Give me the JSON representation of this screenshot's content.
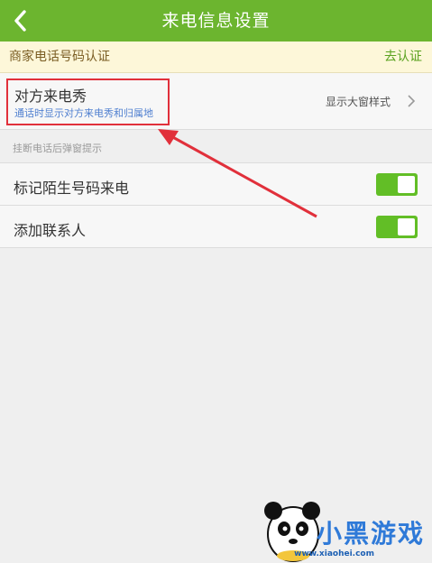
{
  "header": {
    "title": "来电信息设置",
    "back_icon": "chevron-left-icon"
  },
  "merchant_banner": {
    "label": "商家电话号码认证",
    "action": "去认证"
  },
  "caller_show": {
    "title": "对方来电秀",
    "description": "通话时显示对方来电秀和归属地",
    "value": "显示大窗样式",
    "chevron_icon": "chevron-right-icon"
  },
  "section": {
    "title": "挂断电话后弹窗提示"
  },
  "settings": [
    {
      "label": "标记陌生号码来电",
      "enabled": true
    },
    {
      "label": "添加联系人",
      "enabled": true
    }
  ],
  "watermark": {
    "brand": "小黑游戏",
    "site": "www.xiaohei.com"
  },
  "colors": {
    "header": "#6cb52f",
    "toggle_on": "#62be26",
    "highlight": "#e1303b",
    "banner": "#fdf7d9"
  }
}
